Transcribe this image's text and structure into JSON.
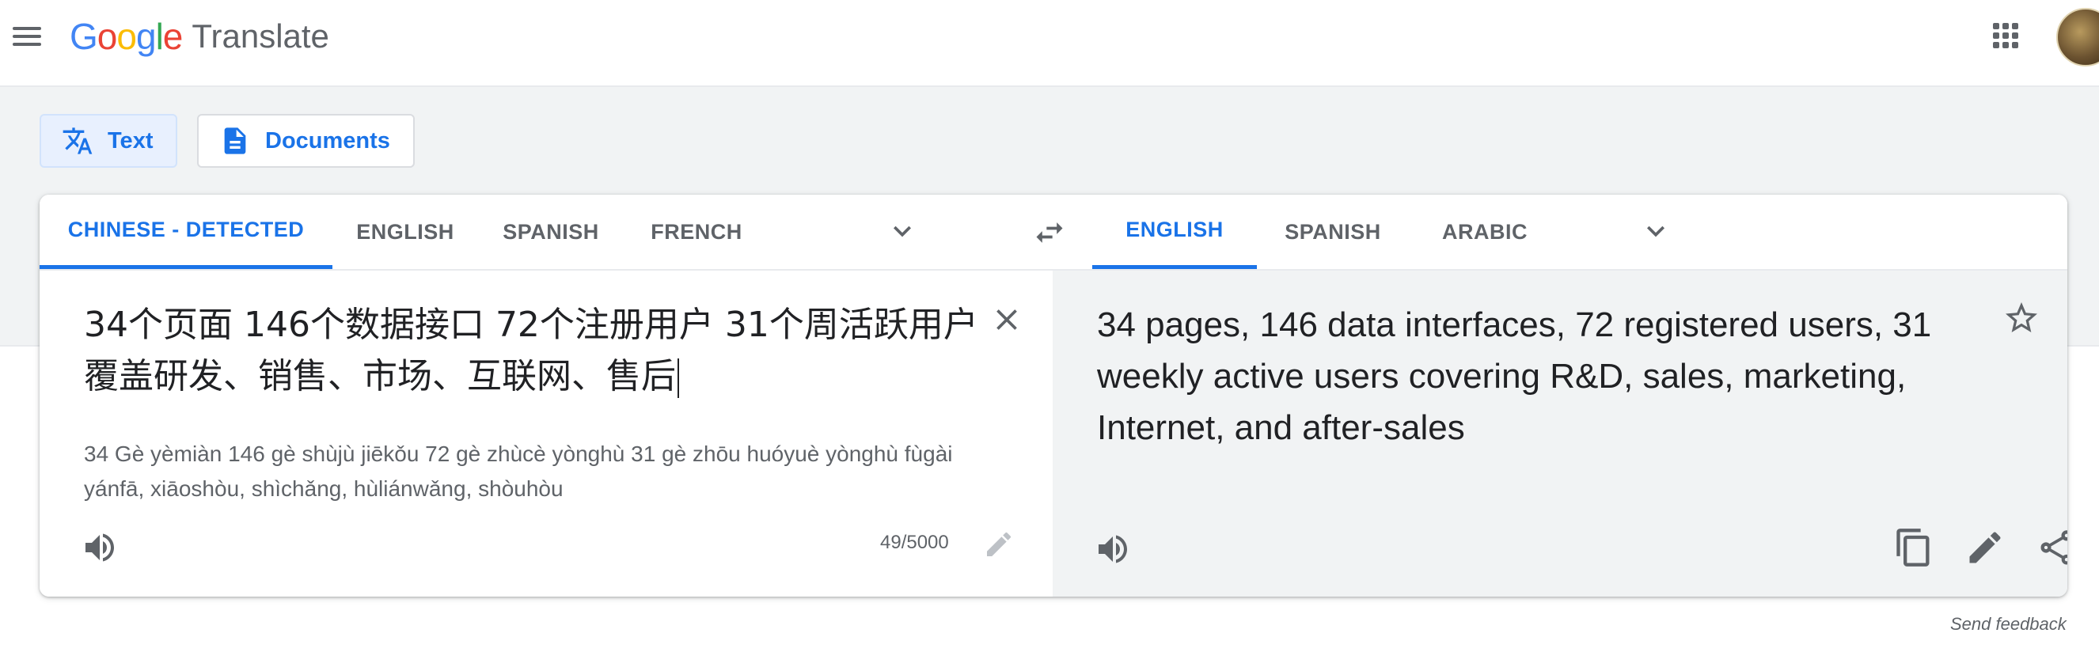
{
  "header": {
    "logo_letters": [
      {
        "char": "G",
        "color": "#4285f4"
      },
      {
        "char": "o",
        "color": "#ea4335"
      },
      {
        "char": "o",
        "color": "#fbbc05"
      },
      {
        "char": "g",
        "color": "#4285f4"
      },
      {
        "char": "l",
        "color": "#34a853"
      },
      {
        "char": "e",
        "color": "#ea4335"
      }
    ],
    "product_name": "Translate",
    "icons": [
      "menu-icon",
      "apps-grid-icon",
      "account-avatar"
    ]
  },
  "modes": {
    "text_label": "Text",
    "documents_label": "Documents",
    "icons": [
      "translate-icon",
      "document-icon"
    ]
  },
  "source_langs": {
    "tabs": [
      "CHINESE - DETECTED",
      "ENGLISH",
      "SPANISH",
      "FRENCH"
    ],
    "active_index": 0
  },
  "target_langs": {
    "tabs": [
      "ENGLISH",
      "SPANISH",
      "ARABIC"
    ],
    "active_index": 0
  },
  "source": {
    "text": "34个页面 146个数据接口 72个注册用户 31个周活跃用户 覆盖研发、销售、市场、互联网、售后",
    "transliteration": "34 Gè yèmiàn 146 gè shùjù jiēkǒu 72 gè zhùcè yònghù 31 gè zhōu huóyuè yònghù fùgài yánfā, xiāoshòu, shìchǎng, hùliánwǎng, shòuhòu",
    "char_count": "49/5000"
  },
  "target": {
    "text": "34 pages, 146 data interfaces, 72 registered users, 31 weekly active users covering R&D, sales, marketing, Internet, and after-sales"
  },
  "footer": {
    "feedback_label": "Send feedback"
  },
  "colors": {
    "accent": "#1a73e8",
    "accent_bg": "#e8f0fe",
    "icon_grey": "#5f6368",
    "band_grey": "#f1f3f4"
  }
}
